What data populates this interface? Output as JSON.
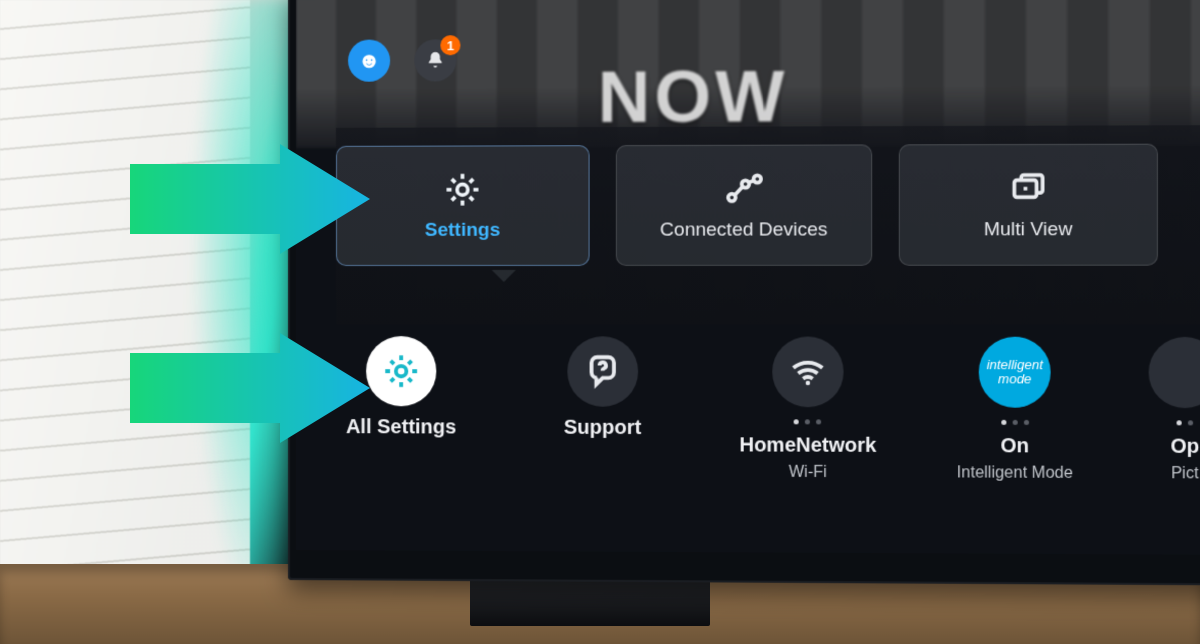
{
  "video_overlay_text": "NOW",
  "notification_badge": "1",
  "tiles": [
    {
      "label": "Settings",
      "selected": true
    },
    {
      "label": "Connected Devices",
      "selected": false
    },
    {
      "label": "Multi View",
      "selected": false
    }
  ],
  "subitems": [
    {
      "label": "All Settings",
      "sublabel": "",
      "selected": true
    },
    {
      "label": "Support",
      "sublabel": ""
    },
    {
      "label": "HomeNetwork",
      "sublabel": "Wi-Fi"
    },
    {
      "label": "On",
      "sublabel": "Intelligent Mode",
      "intelligent": true,
      "badge_top": "intelligent",
      "badge_bottom": "mode"
    },
    {
      "label": "Op",
      "sublabel": "Pict"
    }
  ]
}
